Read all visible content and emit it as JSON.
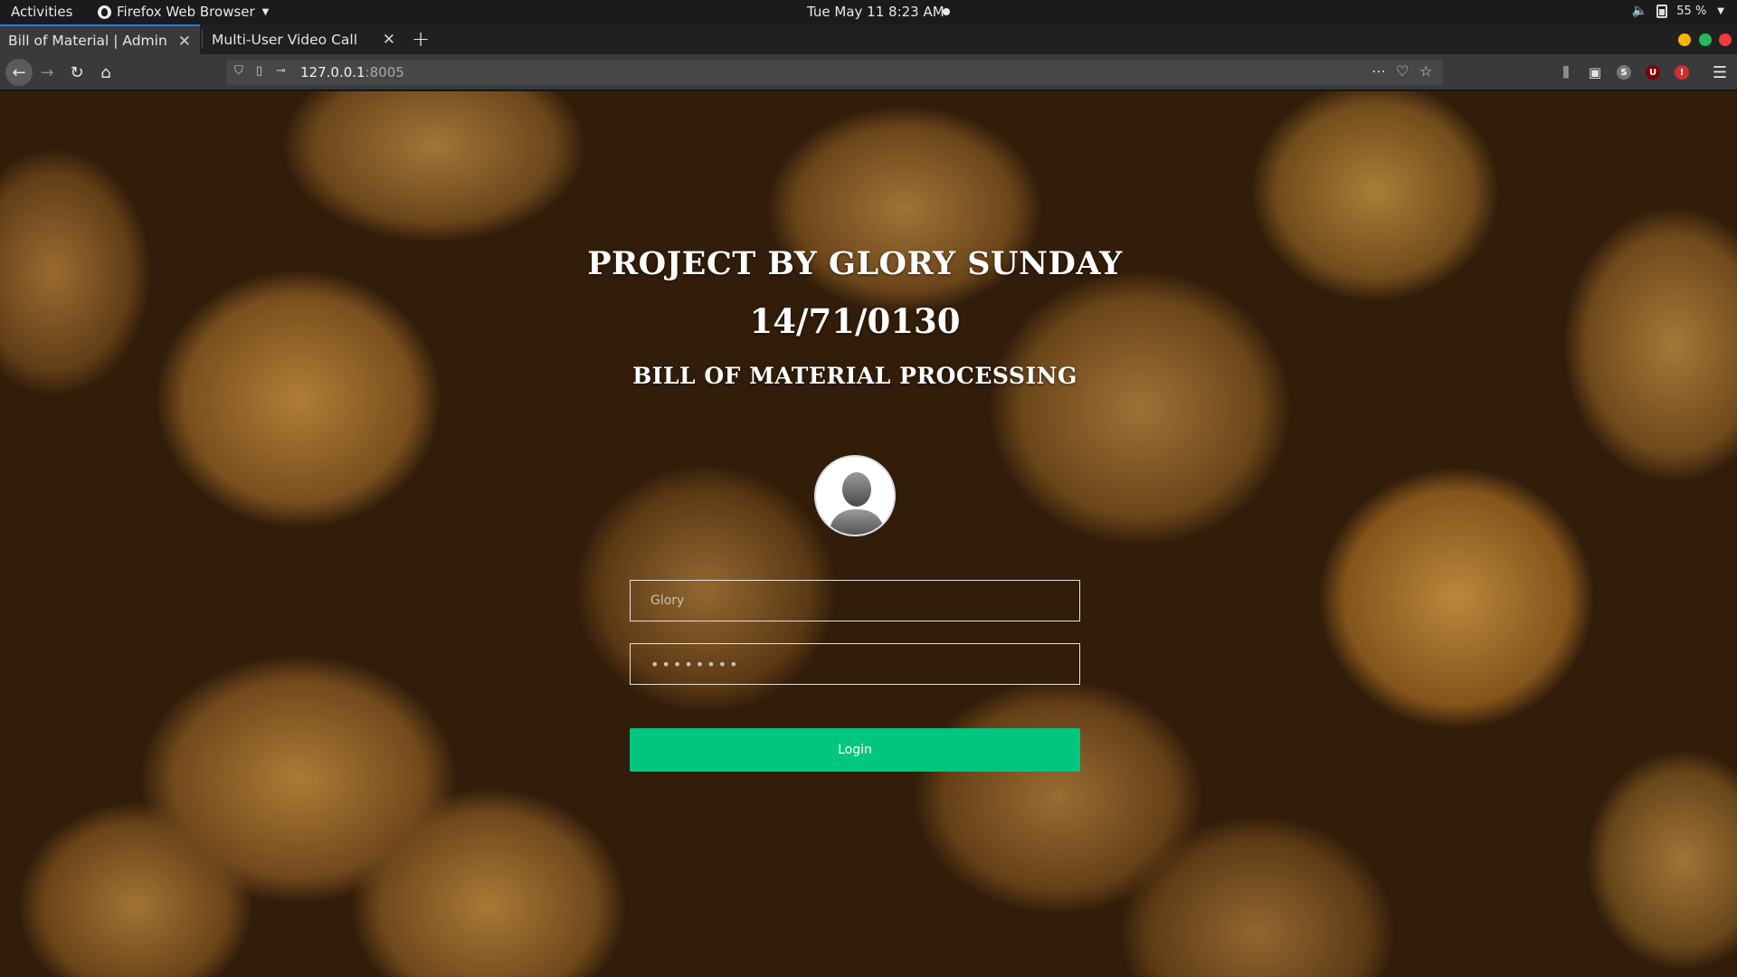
{
  "system": {
    "activities": "Activities",
    "app_name": "Firefox Web Browser",
    "clock": "Tue May 11  8:23 AM",
    "battery": "55 %"
  },
  "browser": {
    "tabs": [
      {
        "title": "Bill of Material | Admin",
        "active": true
      },
      {
        "title": "Multi-User Video Call",
        "active": false
      }
    ],
    "url_host": "127.0.0.1",
    "url_port": ":8005"
  },
  "page": {
    "heading_project": "PROJECT BY GLORY SUNDAY",
    "heading_id": "14/71/0130",
    "heading_subtitle": "BILL OF MATERIAL PROCESSING",
    "username_value": "Glory",
    "password_value": "••••••••",
    "login_label": "Login"
  },
  "colors": {
    "login_button": "#00c67f",
    "tab_accent": "#0a84ff"
  },
  "icons": [
    "firefox-icon",
    "back-arrow-icon",
    "forward-arrow-icon",
    "reload-icon",
    "home-icon",
    "shield-icon",
    "page-icon",
    "key-icon",
    "more-icon",
    "pocket-icon",
    "star-icon",
    "library-icon",
    "sidebar-icon",
    "sync-icon",
    "ublock-icon",
    "extension-icon",
    "hamburger-menu-icon",
    "speaker-icon",
    "battery-icon",
    "user-avatar-icon"
  ]
}
